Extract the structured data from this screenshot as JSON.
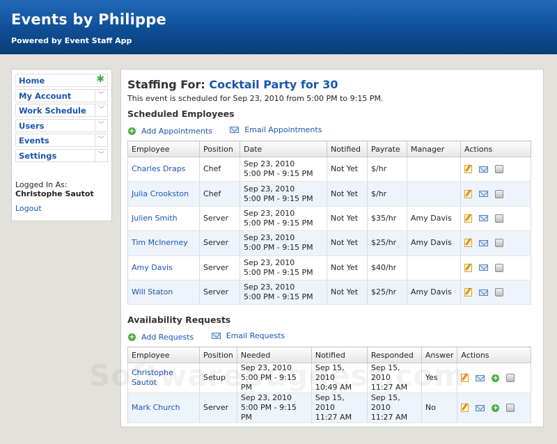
{
  "header": {
    "title": "Events by Philippe",
    "subtitle": "Powered by Event Staff App"
  },
  "sidebar": {
    "items": [
      {
        "label": "Home",
        "active": true
      },
      {
        "label": "My Account"
      },
      {
        "label": "Work Schedule"
      },
      {
        "label": "Users"
      },
      {
        "label": "Events"
      },
      {
        "label": "Settings"
      }
    ],
    "logged_in_label": "Logged In As:",
    "logged_in_user": "Christophe Sautot",
    "logout_label": "Logout"
  },
  "main": {
    "title_prefix": "Staffing For:",
    "event_name": "Cocktail Party for 30",
    "schedule_text": "This event is scheduled for Sep 23, 2010 from 5:00 PM to 9:15 PM.",
    "scheduled": {
      "title": "Scheduled Employees",
      "add_label": "Add Appointments",
      "email_label": "Email Appointments",
      "columns": [
        "Employee",
        "Position",
        "Date",
        "Notified",
        "Payrate",
        "Manager",
        "Actions"
      ],
      "rows": [
        {
          "employee": "Charles Draps",
          "position": "Chef",
          "date1": "Sep 23, 2010",
          "date2": "5:00 PM - 9:15 PM",
          "notified": "Not Yet",
          "payrate": "$/hr",
          "manager": ""
        },
        {
          "employee": "Julia Crookston",
          "position": "Chef",
          "date1": "Sep 23, 2010",
          "date2": "5:00 PM - 9:15 PM",
          "notified": "Not Yet",
          "payrate": "$/hr",
          "manager": ""
        },
        {
          "employee": "Julien Smith",
          "position": "Server",
          "date1": "Sep 23, 2010",
          "date2": "5:00 PM - 9:15 PM",
          "notified": "Not Yet",
          "payrate": "$35/hr",
          "manager": "Amy Davis"
        },
        {
          "employee": "Tim McInerney",
          "position": "Server",
          "date1": "Sep 23, 2010",
          "date2": "5:00 PM - 9:15 PM",
          "notified": "Not Yet",
          "payrate": "$25/hr",
          "manager": "Amy Davis"
        },
        {
          "employee": "Amy Davis",
          "position": "Server",
          "date1": "Sep 23, 2010",
          "date2": "5:00 PM - 9:15 PM",
          "notified": "Not Yet",
          "payrate": "$40/hr",
          "manager": ""
        },
        {
          "employee": "Will Staton",
          "position": "Server",
          "date1": "Sep 23, 2010",
          "date2": "5:00 PM - 9:15 PM",
          "notified": "Not Yet",
          "payrate": "$25/hr",
          "manager": "Amy Davis"
        }
      ]
    },
    "availability": {
      "title": "Availability Requests",
      "add_label": "Add Requests",
      "email_label": "Email Requests",
      "columns": [
        "Employee",
        "Position",
        "Needed",
        "Notified",
        "Responded",
        "Answer",
        "Actions"
      ],
      "rows": [
        {
          "employee": "Christophe Sautot",
          "position": "Setup",
          "needed1": "Sep 23, 2010",
          "needed2": "5:00 PM - 9:15 PM",
          "notified1": "Sep 15, 2010",
          "notified2": "10:49 AM",
          "responded1": "Sep 15, 2010",
          "responded2": "11:27 AM",
          "answer": "Yes"
        },
        {
          "employee": "Mark Church",
          "position": "Server",
          "needed1": "Sep 23, 2010",
          "needed2": "5:00 PM - 9:15 PM",
          "notified1": "Sep 15, 2010",
          "notified2": "11:27 AM",
          "responded1": "Sep 15, 2010",
          "responded2": "11:27 AM",
          "answer": "No"
        }
      ]
    }
  },
  "watermark": "SoftwareSuggest.com"
}
